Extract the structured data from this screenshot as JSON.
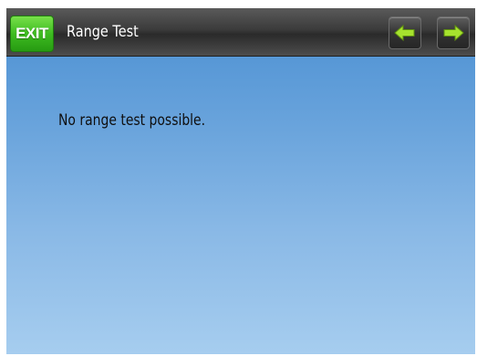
{
  "header": {
    "exit_label": "EXIT",
    "title": "Range Test",
    "prev_icon": "arrow-left-icon",
    "next_icon": "arrow-right-icon"
  },
  "main": {
    "message": "No range test possible."
  },
  "colors": {
    "exit_button": "#3dbb20",
    "arrow_icon": "#a6e22e",
    "background_top": "#4a8fd2",
    "background_bottom": "#a6cdef"
  }
}
